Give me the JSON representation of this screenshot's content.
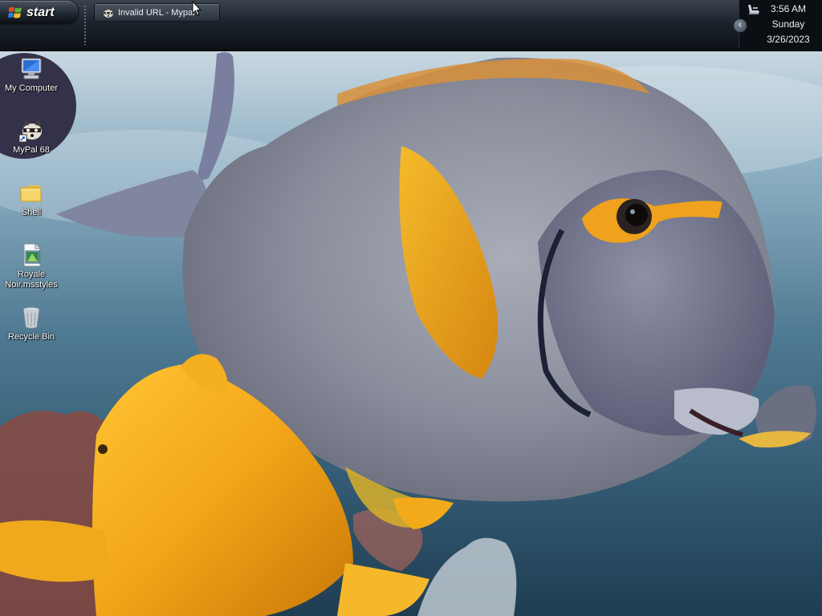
{
  "taskbar": {
    "start_label": "start",
    "tasks": [
      {
        "label": "Invalid URL - Mypal"
      }
    ],
    "clock": {
      "time": "3:56 AM",
      "day": "Sunday",
      "date": "3/26/2023"
    },
    "tray_collapse_glyph": "‹"
  },
  "desktop": {
    "icons": [
      {
        "label": "My Computer",
        "icon": "my-computer-icon"
      },
      {
        "label": "MyPal 68",
        "icon": "mypal-browser-icon"
      },
      {
        "label": "Shell",
        "icon": "folder-icon"
      },
      {
        "label": "Royale Noir.msstyles",
        "icon": "msstyles-file-icon"
      },
      {
        "label": "Recycle Bin",
        "icon": "recycle-bin-icon"
      }
    ]
  },
  "colors": {
    "taskbar_top": "#3a4450",
    "taskbar_bottom": "#0d1217",
    "water": "#4e7c95",
    "fish_body": "#8c8f9c",
    "fish_yellow": "#f0a21a"
  }
}
